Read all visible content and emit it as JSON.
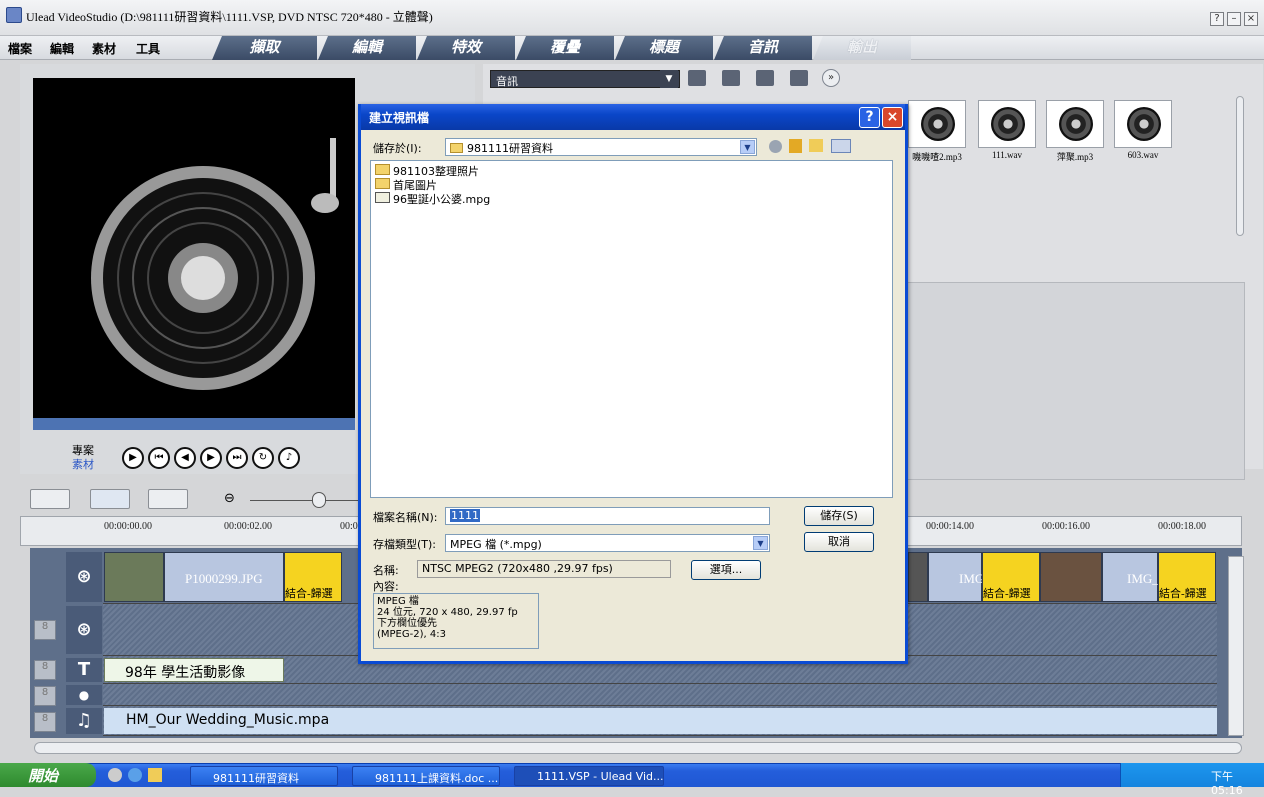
{
  "window": {
    "title": "Ulead VideoStudio (D:\\981111研習資料\\1111.VSP, DVD NTSC 720*480 - 立體聲)",
    "controls": [
      "?",
      "–",
      "×"
    ]
  },
  "menu": [
    "檔案",
    "編輯",
    "素材",
    "工具"
  ],
  "steps": [
    "擷取",
    "編輯",
    "特效",
    "覆疊",
    "標題",
    "音訊",
    "輸出"
  ],
  "preview": {
    "project_label": "專案",
    "clip_label": "素材"
  },
  "library": {
    "category": "音訊",
    "items": [
      "嘰嘰喳2.mp3",
      "111.wav",
      "萍聚.mp3",
      "603.wav"
    ]
  },
  "ruler": {
    "ticks": [
      "00:00:00.00",
      "00:00:02.00",
      "00:0",
      "00:00:14.00",
      "00:00:16.00",
      "00:00:18.00"
    ]
  },
  "timeline": {
    "video_clips": [
      "P1000299.JPG",
      "IMG_",
      "IMG_"
    ],
    "transition_label": "結合-歸選",
    "title_clip": "98年 學生活動影像",
    "music_clip": "HM_Our Wedding_Music.mpa"
  },
  "dialog": {
    "title": "建立視訊檔",
    "save_in_label": "儲存於(I):",
    "save_in_value": "981111研習資料",
    "files": [
      {
        "name": "981103整理照片",
        "type": "folder"
      },
      {
        "name": "首尾圖片",
        "type": "folder"
      },
      {
        "name": "96聖誕小公婆.mpg",
        "type": "mpg"
      }
    ],
    "filename_label": "檔案名稱(N):",
    "filename_value": "1111",
    "filetype_label": "存檔類型(T):",
    "filetype_value": "MPEG 檔 (*.mpg)",
    "name_label": "名稱:",
    "name_value": "NTSC   MPEG2 (720x480 ,29.97 fps)",
    "content_label": "內容:",
    "content_lines": [
      "MPEG 檔",
      "24 位元, 720 x 480, 29.97 fp",
      "下方欄位優先",
      "(MPEG-2), 4:3"
    ],
    "save_button": "儲存(S)",
    "cancel_button": "取消",
    "options_button": "選項..."
  },
  "taskbar": {
    "start": "開始",
    "tasks": [
      "981111研習資料",
      "981111上課資料.doc ...",
      "1111.VSP - Ulead Vid..."
    ],
    "clock": "下午 05:16"
  },
  "colors": {
    "dialog_title": "#0a46c8",
    "timeline_bg": "#5e6f8a",
    "taskbar": "#245edb"
  }
}
